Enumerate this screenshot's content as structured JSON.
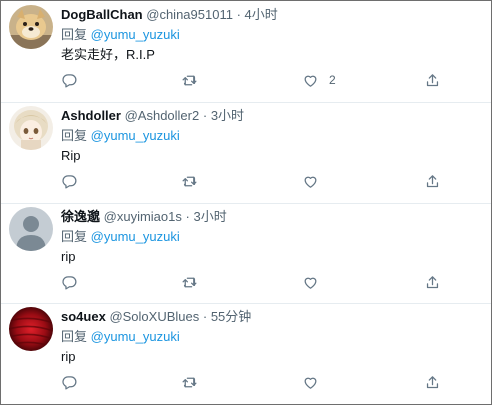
{
  "replies": [
    {
      "name": "DogBallChan",
      "handle": "@china951011",
      "sep": "·",
      "time": "4小时",
      "reply_prefix": "回复",
      "mention": "@yumu_yuzuki",
      "text": "老实走好，R.I.P",
      "like_count": "2"
    },
    {
      "name": "Ashdoller",
      "handle": "@Ashdoller2",
      "sep": "·",
      "time": "3小时",
      "reply_prefix": "回复",
      "mention": "@yumu_yuzuki",
      "text": "Rip",
      "like_count": ""
    },
    {
      "name": "徐逸邈",
      "handle": "@xuyimiao1s",
      "sep": "·",
      "time": "3小时",
      "reply_prefix": "回复",
      "mention": "@yumu_yuzuki",
      "text": "rip",
      "like_count": ""
    },
    {
      "name": "so4uex",
      "handle": "@SoloXUBlues",
      "sep": "·",
      "time": "55分钟",
      "reply_prefix": "回复",
      "mention": "@yumu_yuzuki",
      "text": "rip",
      "like_count": ""
    }
  ],
  "icons": {
    "reply": "reply-icon",
    "retweet": "retweet-icon",
    "like": "heart-icon",
    "share": "share-icon"
  },
  "colors": {
    "mention": "#1b95e0",
    "secondary_text": "#536471",
    "icon": "#657786",
    "divider": "#e6ecf0"
  }
}
